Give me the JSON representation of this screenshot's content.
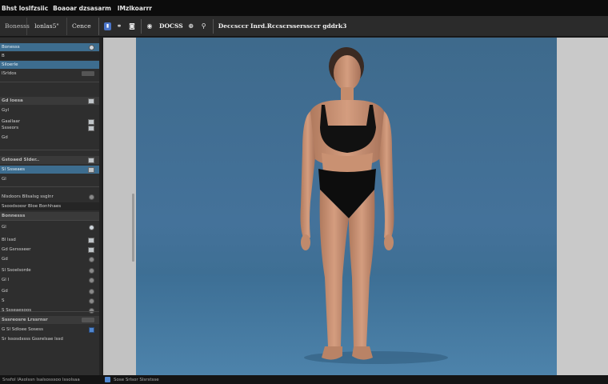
{
  "window": {
    "title_parts": [
      "Bhst loslfzsiic",
      "Boaoar dzsasarm",
      "lMzlkoarrr"
    ]
  },
  "toolbar": {
    "tab_first": "Bonesss",
    "tab_active": "lonlas5\"",
    "tab_plain": "Cence",
    "icons": [
      "layers-icon",
      "link-icon",
      "camera-icon",
      "undo-icon",
      "redo-icon"
    ],
    "view_label": "DOCSS",
    "file_label": "Deccsccr Inrd.Rccscrsserssccr gddrk3"
  },
  "left_panel": {
    "rows": [
      {
        "label": "Bonesss",
        "kind": "highlight",
        "ctrl": "knob-light"
      },
      {
        "label": "B",
        "kind": "darkbar",
        "ctrl": ""
      },
      {
        "label": "Siloerle",
        "kind": "highlight",
        "ctrl": ""
      },
      {
        "label": "lSrldos",
        "kind": "plain",
        "ctrl": "pill"
      },
      {
        "label": "Gd  loesa",
        "kind": "section",
        "ctrl": "sq"
      },
      {
        "label": "Gyl",
        "kind": "plain",
        "ctrl": ""
      },
      {
        "label": "Gaallaar",
        "kind": "plain",
        "ctrl": "sq"
      },
      {
        "label": "Ssseors",
        "kind": "plain",
        "ctrl": "sq"
      },
      {
        "label": "Gd",
        "kind": "plain",
        "ctrl": ""
      },
      {
        "label": "Gstoaed  Slder..",
        "kind": "section",
        "ctrl": "sq"
      },
      {
        "label": "Sl  Ssseaes",
        "kind": "highlight",
        "ctrl": "sq"
      },
      {
        "label": "Gl",
        "kind": "plain",
        "ctrl": ""
      },
      {
        "label": "Nlsdoors  Bllsalsg ssglnr",
        "kind": "plain",
        "ctrl": "knob"
      },
      {
        "label": "Ssoodsoosr  Bloe Bonhhaes",
        "kind": "darkbar",
        "ctrl": ""
      },
      {
        "label": "Bonnesss",
        "kind": "section",
        "ctrl": ""
      },
      {
        "label": "Gl",
        "kind": "plain",
        "ctrl": "knob-light"
      },
      {
        "label": "Bl  lssd",
        "kind": "plain",
        "ctrl": "sq"
      },
      {
        "label": "Gd  Gsrssseer",
        "kind": "plain",
        "ctrl": "sq"
      },
      {
        "label": "Gd",
        "kind": "plain",
        "ctrl": "knob"
      },
      {
        "label": "Sl  Ssoelsorde",
        "kind": "plain",
        "ctrl": "knob"
      },
      {
        "label": "Gl  l",
        "kind": "plain",
        "ctrl": "knob"
      },
      {
        "label": "Gd",
        "kind": "plain",
        "ctrl": "knob"
      },
      {
        "label": "S",
        "kind": "plain",
        "ctrl": "knob"
      },
      {
        "label": "S  Ssseaesoos",
        "kind": "plain",
        "ctrl": "knob"
      },
      {
        "label": "Sssreosre  Lrssrnsr",
        "kind": "section",
        "ctrl": "pill"
      },
      {
        "label": "G  Sl Sdloee Sosess",
        "kind": "plain",
        "ctrl": "chk"
      },
      {
        "label": "Sr lssosdssss  Gssrelsae lssd",
        "kind": "plain",
        "ctrl": ""
      }
    ]
  },
  "statusbar": {
    "left": "Snsfol  lAsolssn  lsalsosssoo  lssolsaa",
    "mid": "Sose  Srlsor  Slsrstsse"
  },
  "colors": {
    "panel_highlight": "#3d6d8f",
    "scene_blue": "#44729a",
    "accent": "#4f86cf"
  }
}
